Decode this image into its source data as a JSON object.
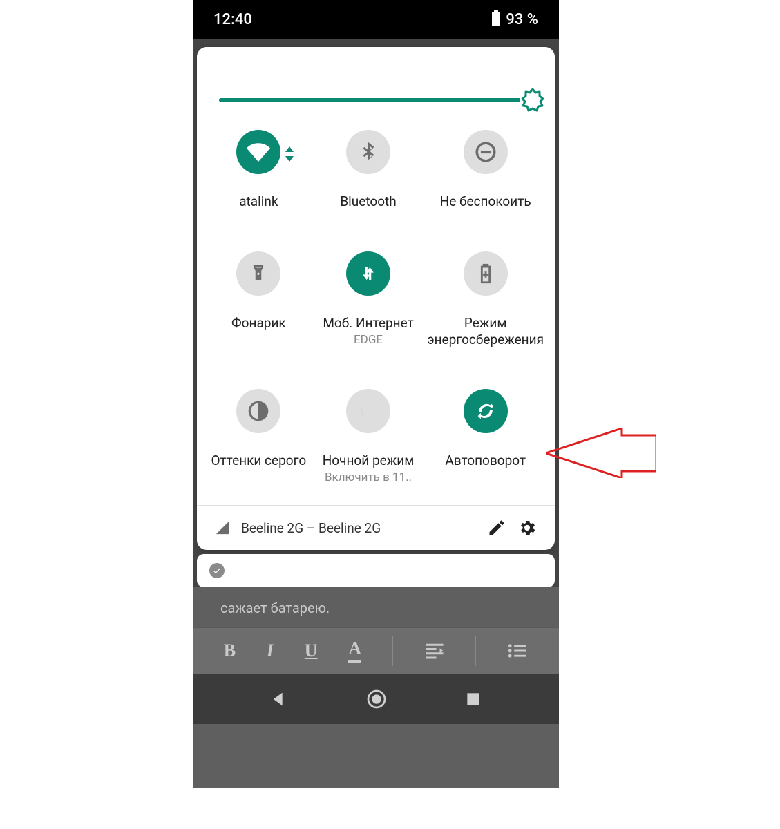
{
  "statusbar": {
    "time": "12:40",
    "battery_text": "93 %"
  },
  "brightness": {
    "value_percent": 100
  },
  "tiles": {
    "wifi": {
      "label": "atalink",
      "sub": ""
    },
    "bluetooth": {
      "label": "Bluetooth",
      "sub": ""
    },
    "dnd": {
      "label": "Не беспокоить",
      "sub": ""
    },
    "flashlight": {
      "label": "Фонарик",
      "sub": ""
    },
    "mobiledata": {
      "label": "Моб. Интернет",
      "sub": "EDGE"
    },
    "battery": {
      "label": "Режим энергосбережения",
      "sub": ""
    },
    "grayscale": {
      "label": "Оттенки серого",
      "sub": ""
    },
    "night": {
      "label": "Ночной режим",
      "sub": "Включить в 11.."
    },
    "autorotate": {
      "label": "Автоповорот",
      "sub": ""
    }
  },
  "footer": {
    "carrier": "Beeline 2G – Beeline 2G"
  },
  "background": {
    "text_fragment": "сажает батарею."
  },
  "colors": {
    "teal": "#0a8a72",
    "tile_off": "#dedede"
  }
}
